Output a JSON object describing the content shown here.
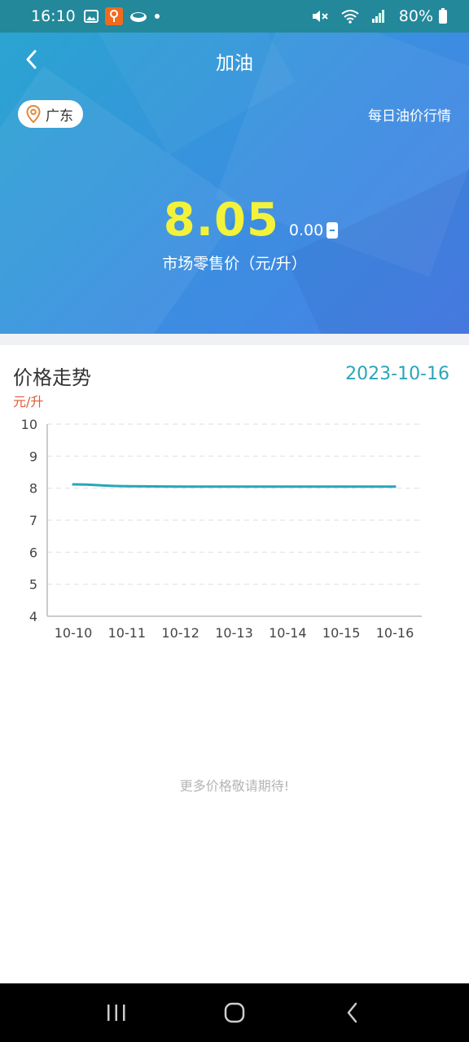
{
  "status_bar": {
    "time": "16:10",
    "battery": "80%",
    "icons": [
      "gallery-icon",
      "app-notification-icon",
      "cloud-icon",
      "dot-icon",
      "mute-icon",
      "wifi-icon",
      "signal-icon",
      "battery-icon"
    ]
  },
  "header": {
    "title": "加油",
    "back_icon": "chevron-left-icon",
    "location": "广东",
    "daily_link": "每日油价行情"
  },
  "price": {
    "value": "8.05",
    "change": "0.00",
    "label": "市场零售价（元/升）",
    "value_color": "#f2f23a"
  },
  "trend": {
    "title": "价格走势",
    "date": "2023-10-16",
    "unit": "元/升"
  },
  "chart_data": {
    "type": "line",
    "x": [
      "10-10",
      "10-11",
      "10-12",
      "10-13",
      "10-14",
      "10-15",
      "10-16"
    ],
    "series": [
      {
        "values": [
          8.12,
          8.06,
          8.05,
          8.05,
          8.05,
          8.05,
          8.05
        ],
        "color": "#2aa6b8"
      }
    ],
    "ylim": [
      4,
      10
    ],
    "yticks": [
      4,
      5,
      6,
      7,
      8,
      9,
      10
    ],
    "grid": true
  },
  "footer": {
    "more_text": "更多价格敬请期待!"
  },
  "nav": {
    "icons": [
      "recent-apps-icon",
      "home-icon",
      "back-icon"
    ]
  }
}
